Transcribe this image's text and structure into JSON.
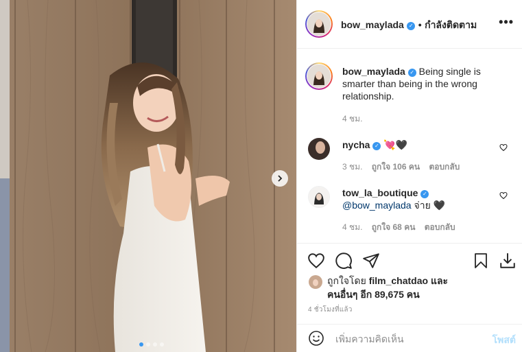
{
  "header": {
    "username": "bow_maylada",
    "follow_label": "กำลังติดตาม",
    "separator": "•",
    "more_label": "•••"
  },
  "caption": {
    "username": "bow_maylada",
    "text": "Being single is smarter than being in the wrong relationship.",
    "time": "4 ชม."
  },
  "comments": [
    {
      "username": "nycha",
      "text": "💘🖤",
      "time": "3 ชม.",
      "likes": "ถูกใจ 106 คน",
      "reply": "ตอบกลับ"
    },
    {
      "username": "tow_la_boutique",
      "mention": "@bow_maylada",
      "text": "จ่าย 🖤",
      "time": "4 ชม.",
      "likes": "ถูกใจ 68 คน",
      "reply": "ตอบกลับ"
    }
  ],
  "likes": {
    "prefix": "ถูกใจโดย",
    "user": "film_chatdao",
    "conj": "และ",
    "others": "คนอื่นๆ อีก 89,675 คน"
  },
  "timestamp": "4 ชั่วโมงที่แล้ว",
  "composer": {
    "placeholder": "เพิ่มความคิดเห็น",
    "post_label": "โพสต์"
  },
  "colors": {
    "accent": "#3897f0",
    "text": "#262626",
    "muted": "#8e8e8e",
    "post_disabled": "#b2dffc"
  },
  "carousel": {
    "slides": 4,
    "active": 1
  }
}
